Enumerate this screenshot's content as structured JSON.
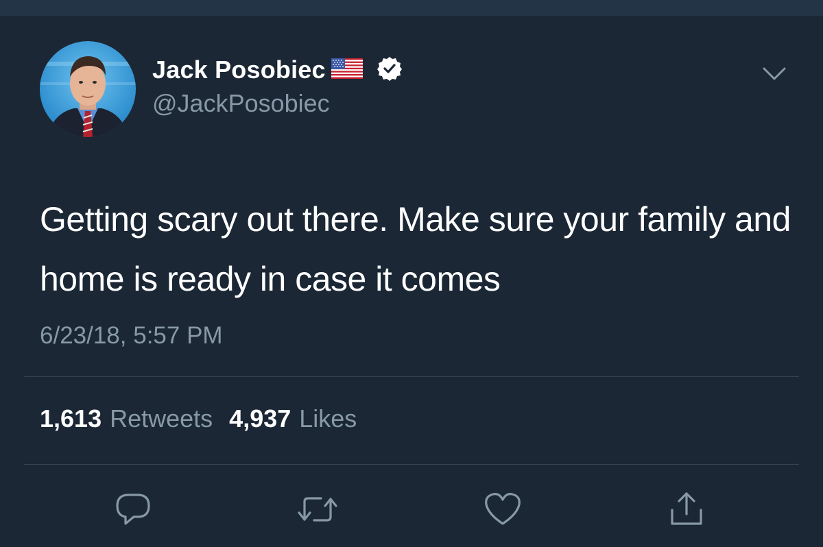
{
  "user": {
    "display_name": "Jack Posobiec",
    "handle": "@JackPosobiec",
    "flag_icon": "us-flag-emoji",
    "verified_icon": "verified-badge-icon"
  },
  "tweet": {
    "text": "Getting scary out there. Make sure your family and home is ready in case it comes",
    "timestamp": "6/23/18, 5:57 PM"
  },
  "stats": {
    "retweet_count": "1,613",
    "retweet_label": "Retweets",
    "like_count": "4,937",
    "like_label": "Likes"
  },
  "actions": {
    "reply_icon": "reply-icon",
    "retweet_icon": "retweet-icon",
    "like_icon": "heart-icon",
    "share_icon": "share-icon",
    "menu_icon": "chevron-down-icon"
  },
  "colors": {
    "background": "#1b2735",
    "secondary_text": "#8899a6",
    "divider": "#38444d"
  }
}
